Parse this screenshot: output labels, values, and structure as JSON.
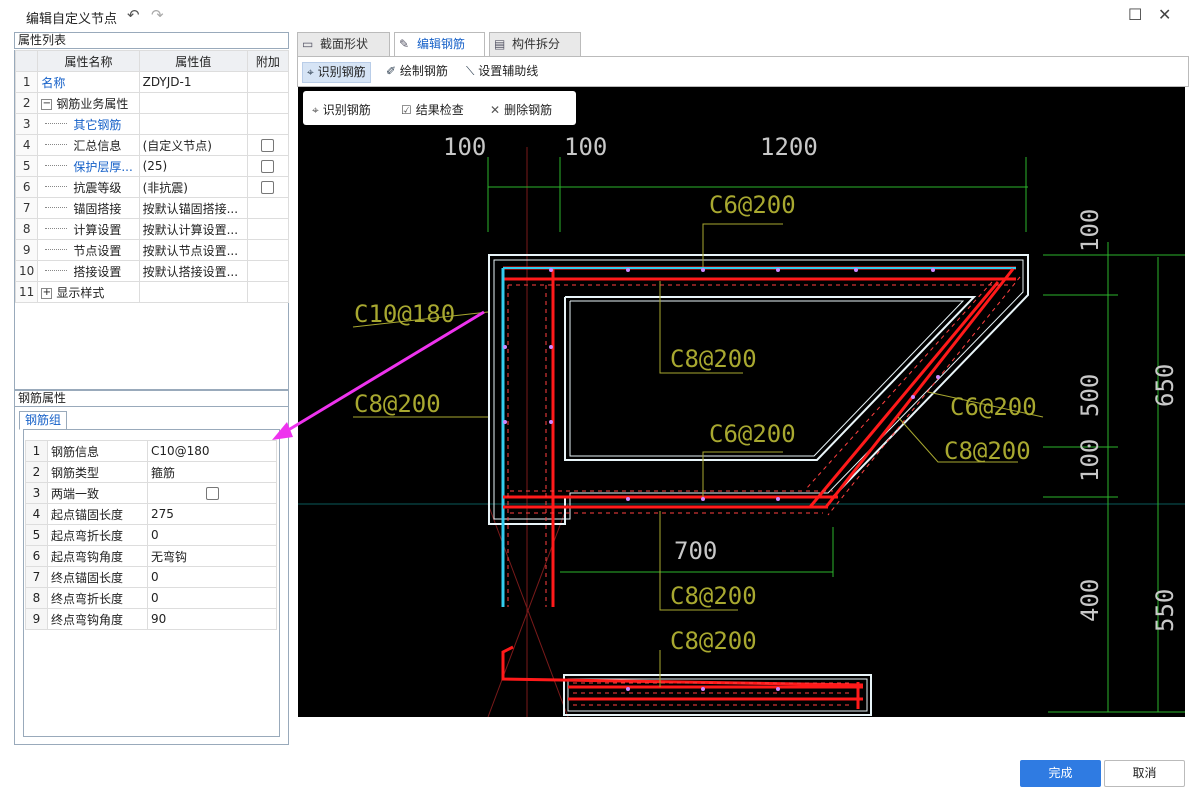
{
  "window": {
    "title": "编辑自定义节点",
    "undo_icon": "↶",
    "redo_icon": "↷",
    "maximize_icon": "☐",
    "close_icon": "✕"
  },
  "property_panel": {
    "header": "属性列表",
    "columns": [
      "属性名称",
      "属性值",
      "附加"
    ],
    "rows": [
      {
        "idx": "1",
        "name": "名称",
        "value": "ZDYJD-1"
      },
      {
        "idx": "2",
        "name": "钢筋业务属性",
        "value": ""
      },
      {
        "idx": "3",
        "name": "其它钢筋",
        "value": ""
      },
      {
        "idx": "4",
        "name": "汇总信息",
        "value": "(自定义节点)"
      },
      {
        "idx": "5",
        "name": "保护层厚...",
        "value": "(25)"
      },
      {
        "idx": "6",
        "name": "抗震等级",
        "value": "(非抗震)"
      },
      {
        "idx": "7",
        "name": "锚固搭接",
        "value": "按默认锚固搭接..."
      },
      {
        "idx": "8",
        "name": "计算设置",
        "value": "按默认计算设置..."
      },
      {
        "idx": "9",
        "name": "节点设置",
        "value": "按默认节点设置..."
      },
      {
        "idx": "10",
        "name": "搭接设置",
        "value": "按默认搭接设置..."
      },
      {
        "idx": "11",
        "name": "显示样式",
        "value": ""
      }
    ],
    "collapse_symbol": "−",
    "expand_symbol": "+"
  },
  "rebar_panel": {
    "header": "钢筋属性",
    "tab": "钢筋组",
    "rows": [
      {
        "idx": "1",
        "key": "钢筋信息",
        "value": "C10@180"
      },
      {
        "idx": "2",
        "key": "钢筋类型",
        "value": "箍筋"
      },
      {
        "idx": "3",
        "key": "两端一致",
        "value": ""
      },
      {
        "idx": "4",
        "key": "起点锚固长度",
        "value": "275"
      },
      {
        "idx": "5",
        "key": "起点弯折长度",
        "value": "0"
      },
      {
        "idx": "6",
        "key": "起点弯钩角度",
        "value": "无弯钩"
      },
      {
        "idx": "7",
        "key": "终点锚固长度",
        "value": "0"
      },
      {
        "idx": "8",
        "key": "终点弯折长度",
        "value": "0"
      },
      {
        "idx": "9",
        "key": "终点弯钩角度",
        "value": "90"
      }
    ]
  },
  "tabs": [
    {
      "label": "截面形状",
      "icon": "section-shape-icon"
    },
    {
      "label": "编辑钢筋",
      "icon": "edit-rebar-icon"
    },
    {
      "label": "构件拆分",
      "icon": "split-component-icon"
    }
  ],
  "toolbar": {
    "identify": "识别钢筋",
    "draw": "绘制钢筋",
    "guide": "设置辅助线"
  },
  "float_toolbar": {
    "identify": "识别钢筋",
    "check": "结果检查",
    "delete": "删除钢筋"
  },
  "drawing": {
    "dims": {
      "d100_left": "100",
      "d100_right": "100",
      "d1200": "1200",
      "d700": "700",
      "v100_top": "100",
      "v500": "500",
      "v100_mid": "100",
      "v400": "400",
      "v650": "650",
      "v550": "550"
    },
    "labels": {
      "c6_top": "C6@200",
      "c10": "C10@180",
      "c8_left": "C8@200",
      "c8_mid": "C8@200",
      "c6_mid": "C6@200",
      "c6_right": "C6@200",
      "c8_right": "C8@200",
      "c8_lower": "C8@200",
      "c8_bottom": "C8@200"
    },
    "colors": {
      "background": "#000000",
      "concrete": "#ffffff",
      "rebar": "#ff1a1a",
      "highlight": "#33ccee",
      "dim": "#2bb52b",
      "label": "#a8a830",
      "arrow": "#ee33ee"
    }
  },
  "footer": {
    "confirm": "完成",
    "cancel": "取消"
  }
}
